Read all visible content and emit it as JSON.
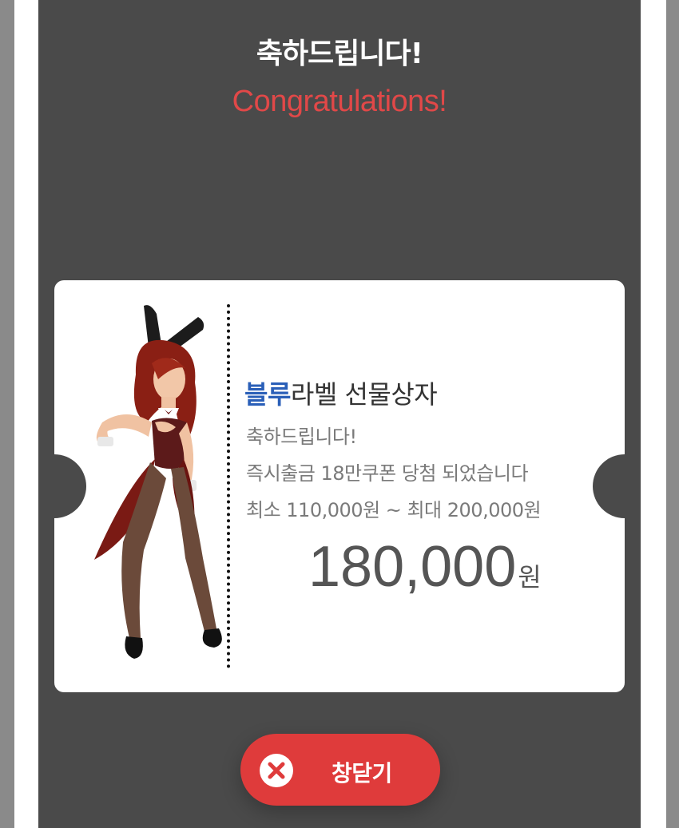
{
  "header": {
    "title_ko": "축하드립니다!",
    "title_en": "Congratulations!"
  },
  "ticket": {
    "title_highlight": "블루",
    "title_rest": "라벨 선물상자",
    "line1": "축하드립니다!",
    "line2": "즉시출금 18만쿠폰 당첨 되었습니다",
    "line3": "최소 110,000원 ~ 최대 200,000원",
    "amount": "180,000",
    "amount_unit": "원"
  },
  "close_button": {
    "label": "창닫기",
    "icon": "close-icon"
  },
  "colors": {
    "modal_bg": "#4a4a4a",
    "accent_red": "#df3b3b",
    "title_en_red": "#e14848",
    "highlight_blue": "#2a5fb8"
  }
}
